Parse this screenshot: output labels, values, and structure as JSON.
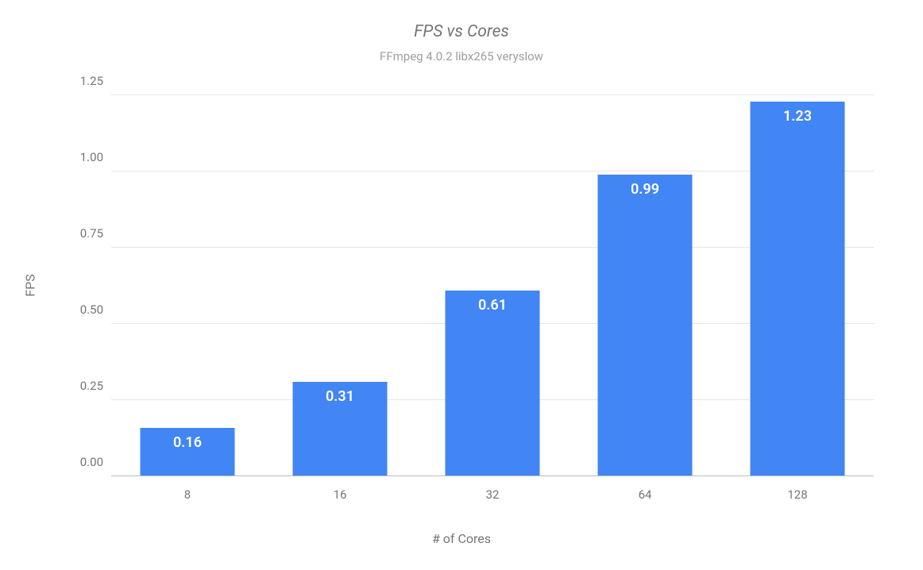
{
  "chart_data": {
    "type": "bar",
    "title": "FPS vs Cores",
    "subtitle": "FFmpeg 4.0.2 libx265 veryslow",
    "xlabel": "# of Cores",
    "ylabel": "FPS",
    "categories": [
      "8",
      "16",
      "32",
      "64",
      "128"
    ],
    "values": [
      0.16,
      0.31,
      0.61,
      0.99,
      1.23
    ],
    "value_labels": [
      "0.16",
      "0.31",
      "0.61",
      "0.99",
      "1.23"
    ],
    "ylim": [
      0.0,
      1.25
    ],
    "yticks": [
      0.0,
      0.25,
      0.5,
      0.75,
      1.0,
      1.25
    ],
    "ytick_labels": [
      "0.00",
      "0.25",
      "0.50",
      "0.75",
      "1.00",
      "1.25"
    ],
    "bar_color": "#4285f4"
  }
}
